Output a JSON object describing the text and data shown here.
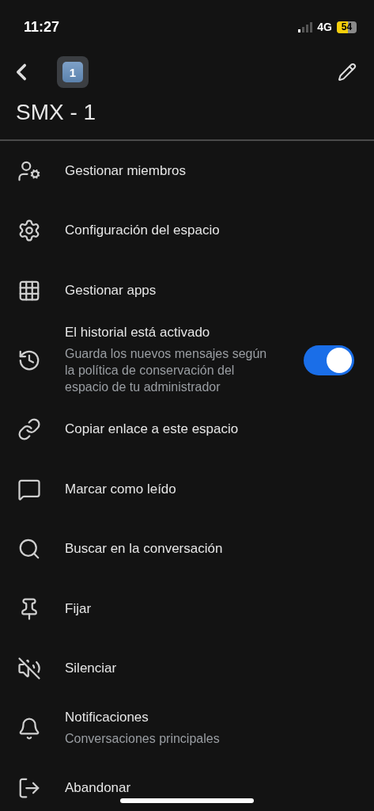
{
  "status_bar": {
    "time": "11:27",
    "network": "4G",
    "battery": "54"
  },
  "header": {
    "badge": "1",
    "title": "SMX - 1"
  },
  "items": [
    {
      "kind": "plain",
      "label": "Gestionar miembros"
    },
    {
      "kind": "plain",
      "label": "Configuración del espacio"
    },
    {
      "kind": "plain",
      "label": "Gestionar apps"
    },
    {
      "kind": "toggle",
      "label": "El historial está activado",
      "description": "Guarda los nuevos mensajes según la política de conservación del espacio de tu administrador",
      "on": true
    },
    {
      "kind": "plain",
      "label": "Copiar enlace a este espacio"
    },
    {
      "kind": "plain",
      "label": "Marcar como leído"
    },
    {
      "kind": "plain",
      "label": "Buscar en la conversación"
    },
    {
      "kind": "plain",
      "label": "Fijar"
    },
    {
      "kind": "plain",
      "label": "Silenciar"
    },
    {
      "kind": "sub",
      "label": "Notificaciones",
      "description": "Conversaciones principales"
    },
    {
      "kind": "plain",
      "label": "Abandonar"
    }
  ]
}
